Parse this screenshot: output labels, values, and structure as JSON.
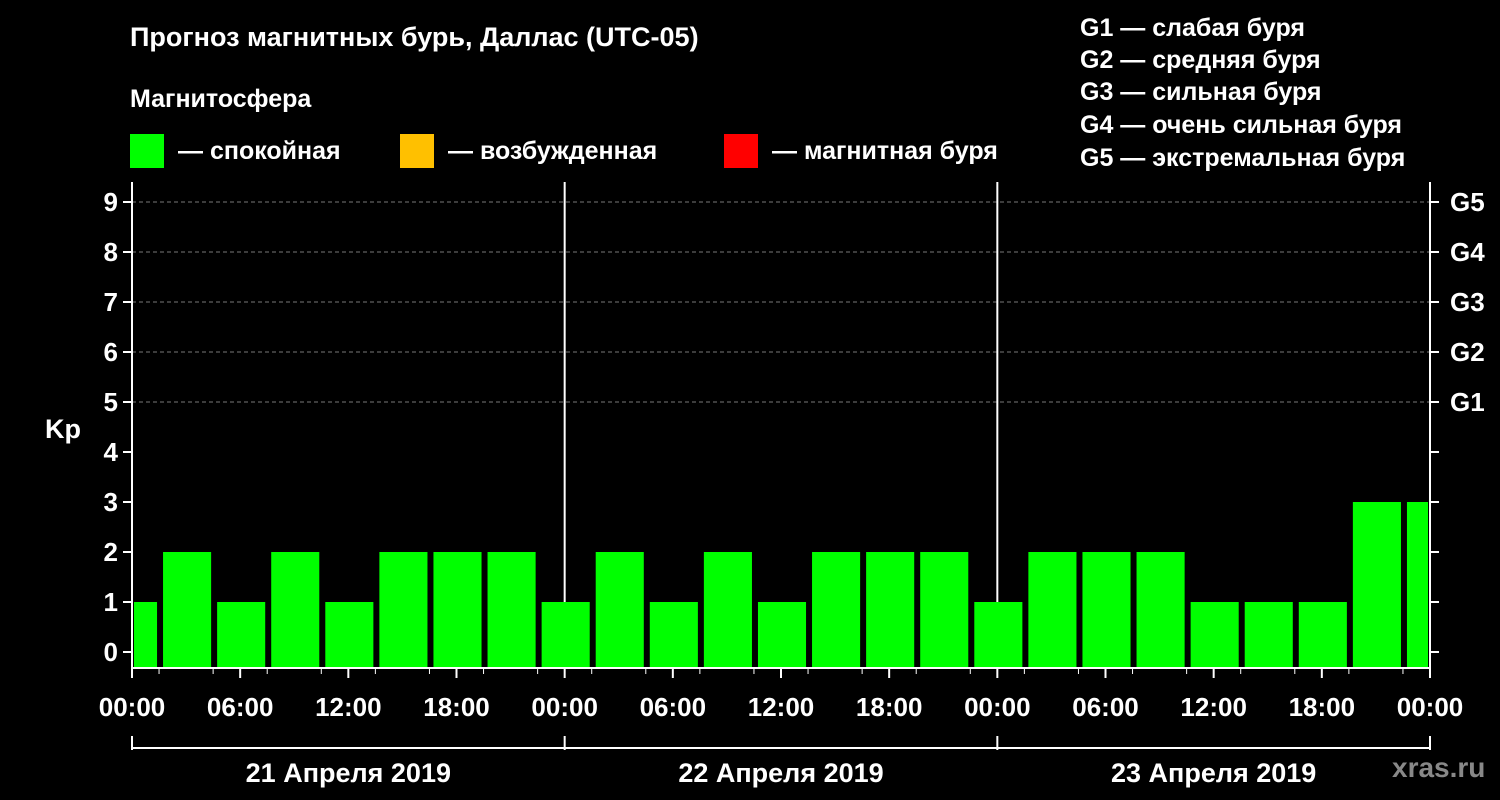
{
  "title": "Прогноз магнитных бурь, Даллас (UTC-05)",
  "legend": {
    "heading": "Магнитосфера",
    "items": [
      {
        "label": "— спокойная",
        "color": "#00ff00"
      },
      {
        "label": "— возбужденная",
        "color": "#ffc000"
      },
      {
        "label": "— магнитная буря",
        "color": "#ff0000"
      }
    ]
  },
  "g_scale": [
    "G1 — слабая буря",
    "G2 — средняя буря",
    "G3 — сильная буря",
    "G4 — очень сильная буря",
    "G5 — экстремальная буря"
  ],
  "watermark": "xras.ru",
  "chart_data": {
    "type": "bar",
    "ylabel": "Kp",
    "ylim": [
      0,
      9
    ],
    "yticks": [
      0,
      1,
      2,
      3,
      4,
      5,
      6,
      7,
      8,
      9
    ],
    "right_labels": [
      {
        "value": 5,
        "label": "G1"
      },
      {
        "value": 6,
        "label": "G2"
      },
      {
        "value": 7,
        "label": "G3"
      },
      {
        "value": 8,
        "label": "G4"
      },
      {
        "value": 9,
        "label": "G5"
      }
    ],
    "grid": true,
    "x_tick_labels": [
      "00:00",
      "06:00",
      "12:00",
      "18:00",
      "00:00",
      "06:00",
      "12:00",
      "18:00",
      "00:00",
      "06:00",
      "12:00",
      "18:00",
      "00:00"
    ],
    "days": [
      "21 Апреля 2019",
      "22 Апреля 2019",
      "23 Апреля 2019"
    ],
    "bar_color": "#00ff00",
    "values": [
      1,
      2,
      1,
      2,
      1,
      2,
      2,
      2,
      1,
      2,
      1,
      2,
      1,
      2,
      2,
      2,
      1,
      2,
      2,
      2,
      1,
      1,
      1,
      3,
      3
    ]
  }
}
